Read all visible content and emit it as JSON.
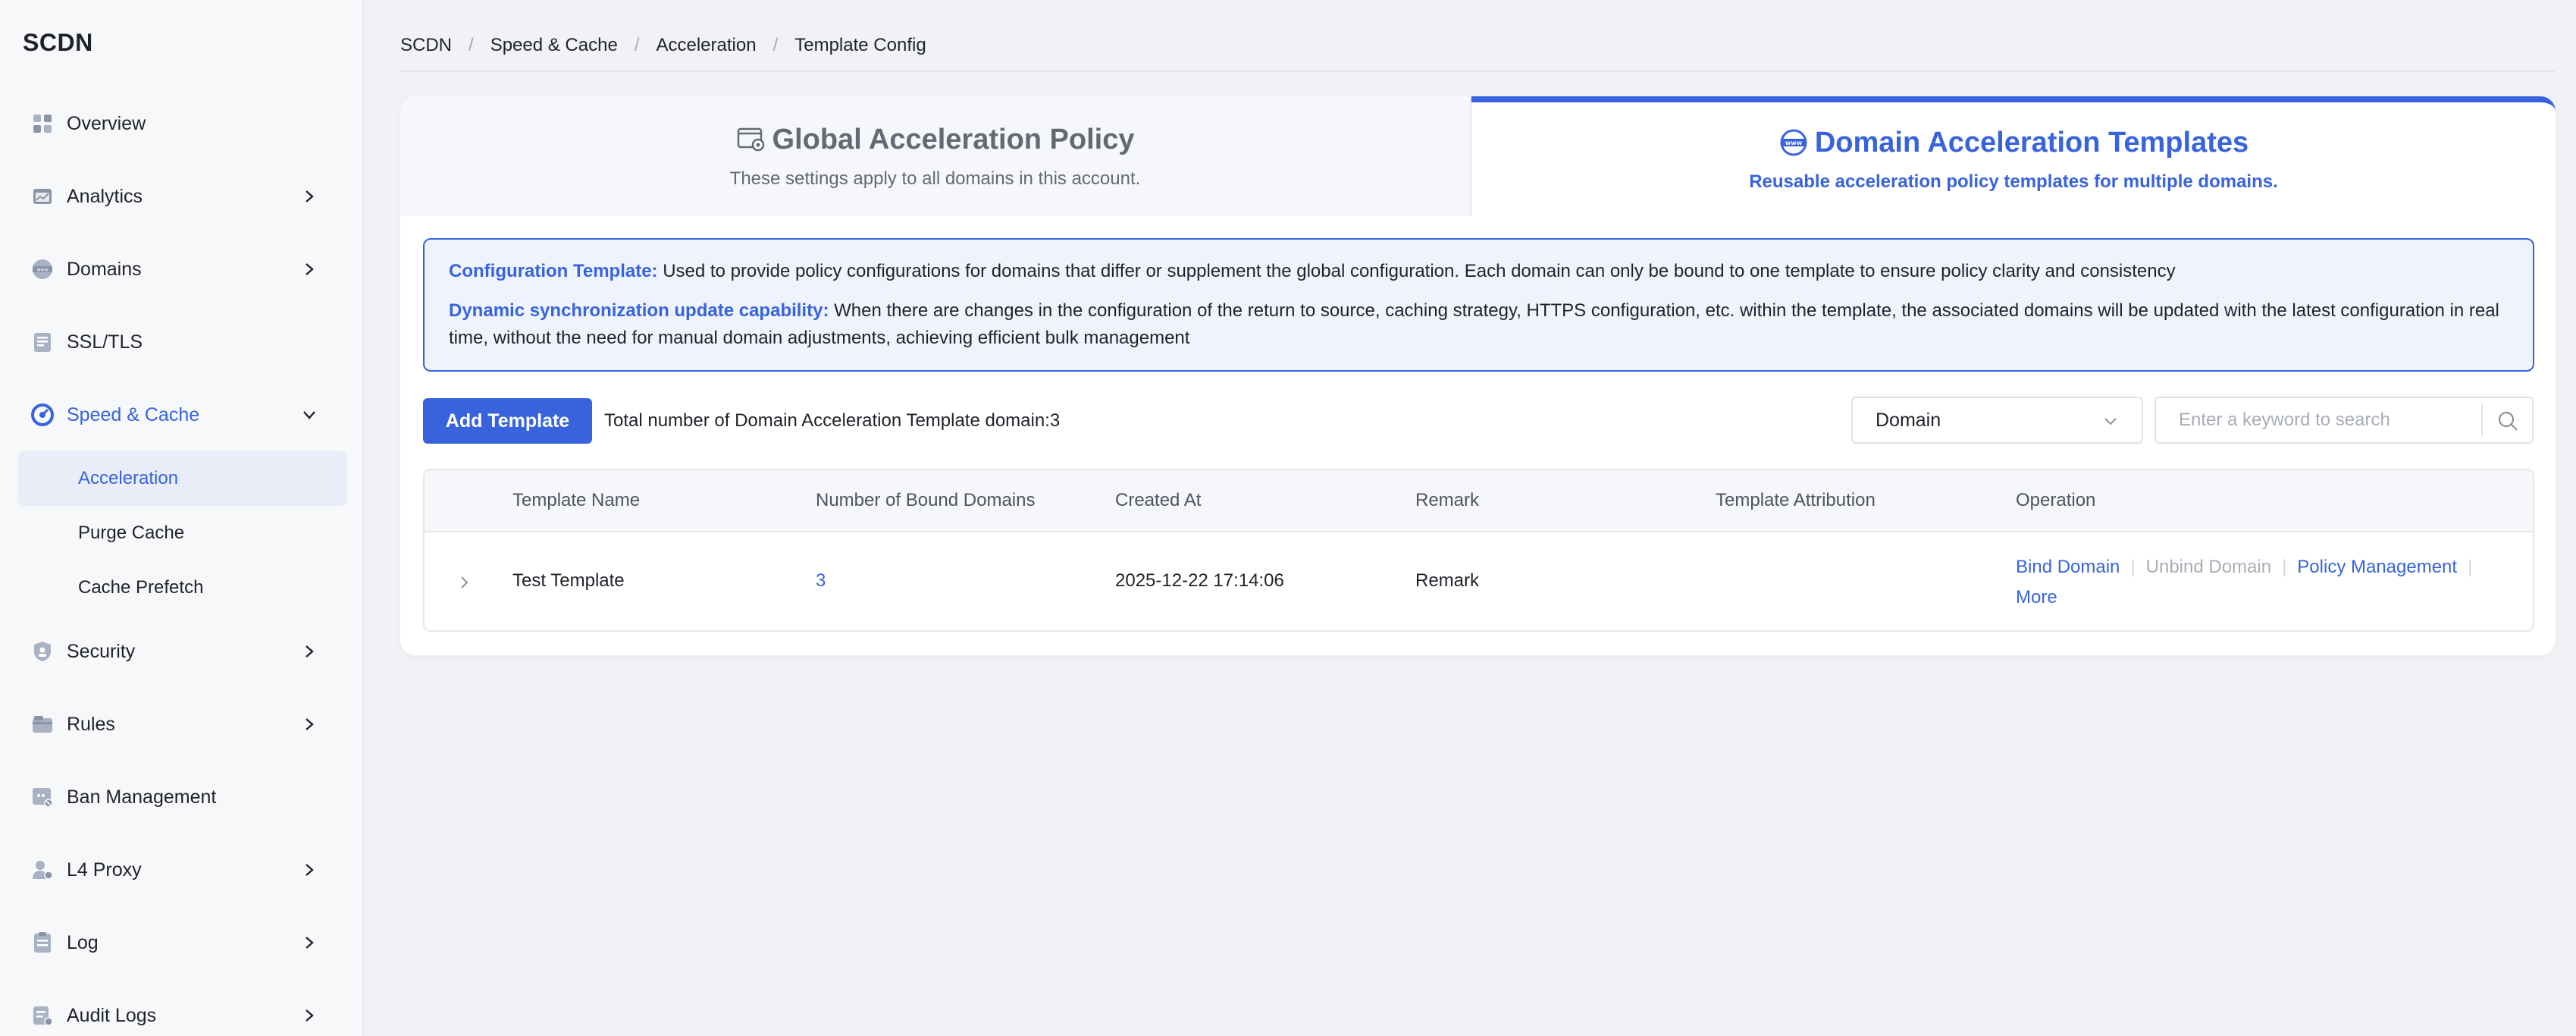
{
  "sidebar": {
    "brand": "SCDN",
    "items": [
      {
        "label": "Overview"
      },
      {
        "label": "Analytics"
      },
      {
        "label": "Domains"
      },
      {
        "label": "SSL/TLS"
      },
      {
        "label": "Speed & Cache"
      },
      {
        "label": "Security"
      },
      {
        "label": "Rules"
      },
      {
        "label": "Ban Management"
      },
      {
        "label": "L4 Proxy"
      },
      {
        "label": "Log"
      },
      {
        "label": "Audit Logs"
      }
    ],
    "sub_items": [
      {
        "label": "Acceleration"
      },
      {
        "label": "Purge Cache"
      },
      {
        "label": "Cache Prefetch"
      }
    ]
  },
  "breadcrumb": [
    "SCDN",
    "Speed & Cache",
    "Acceleration",
    "Template Config"
  ],
  "breadcrumb_separator": "/",
  "tabs": [
    {
      "title": "Global Acceleration Policy",
      "subtitle": "These settings apply to all domains in this account.",
      "active": false
    },
    {
      "title": "Domain Acceleration Templates",
      "subtitle": "Reusable acceleration policy templates for multiple domains.",
      "active": true
    }
  ],
  "info": {
    "line1_label": "Configuration Template:",
    "line1_text": " Used to provide policy configurations for domains that differ or supplement the global configuration. Each domain can only be bound to one template to ensure policy clarity and consistency",
    "line2_label": "Dynamic synchronization update capability:",
    "line2_text": " When there are changes in the configuration of the return to source, caching strategy, HTTPS configuration, etc. within the template, the associated domains will be updated with the latest configuration in real time, without the need for manual domain adjustments, achieving efficient bulk management"
  },
  "toolbar": {
    "add_label": "Add Template",
    "total_text": "Total number of Domain Acceleration Template domain:3",
    "filter_selected": "Domain",
    "search_placeholder": "Enter a keyword to search"
  },
  "table": {
    "headers": [
      "Template Name",
      "Number of Bound Domains",
      "Created At",
      "Remark",
      "Template Attribution",
      "Operation"
    ],
    "rows": [
      {
        "name": "Test Template",
        "bound": "3",
        "created": "2025-12-22 17:14:06",
        "remark": "Remark",
        "attribution": "",
        "ops": [
          "Bind Domain",
          "Unbind Domain",
          "Policy Management",
          "More"
        ]
      }
    ],
    "op_separator": "|"
  },
  "colors": {
    "accent": "#3863dc",
    "sidebar_bg": "#f7f8fa",
    "page_bg": "#f0f2f5",
    "info_bg": "#eef3fd",
    "disabled": "#a8adb6"
  },
  "icons": {
    "overview": "grid-icon",
    "analytics": "chart-icon",
    "domains": "globe-icon",
    "ssl": "certificate-icon",
    "speed": "speedometer-icon",
    "security": "shield-icon",
    "rules": "folder-icon",
    "ban": "ban-icon",
    "l4": "user-proxy-icon",
    "log": "document-icon",
    "audit": "audit-icon"
  }
}
